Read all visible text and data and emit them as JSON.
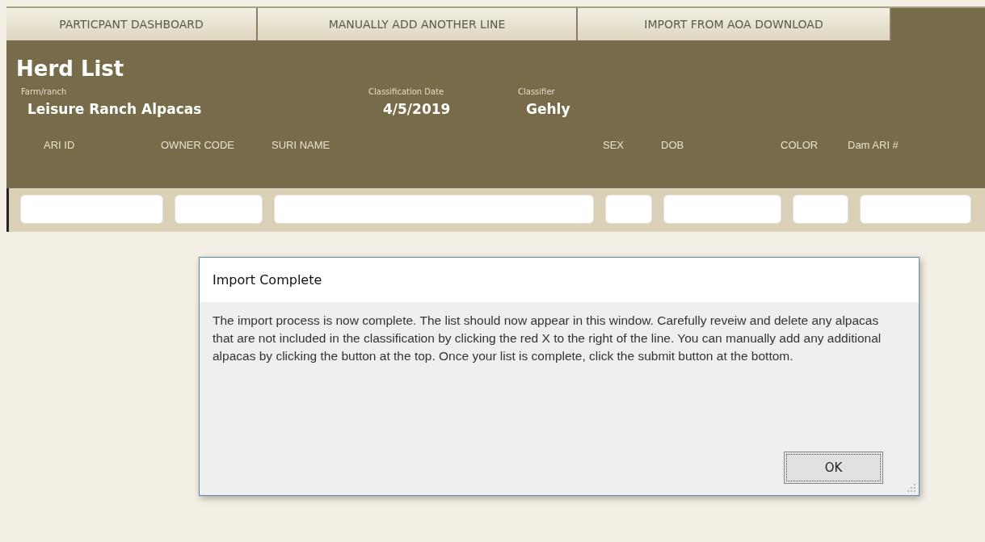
{
  "tabs": [
    {
      "label": "PARTICPANT DASHBOARD"
    },
    {
      "label": "MANUALLY ADD ANOTHER LINE"
    },
    {
      "label": "IMPORT FROM AOA DOWNLOAD"
    }
  ],
  "title": "Herd List",
  "info": [
    {
      "label": "Farm/ranch",
      "value": "Leisure Ranch Alpacas"
    },
    {
      "label": "Classification Date",
      "value": "4/5/2019"
    },
    {
      "label": "Classifier",
      "value": "Gehly"
    }
  ],
  "columns": [
    "ARI ID",
    "OWNER CODE",
    "SURI NAME",
    "SEX",
    "DOB",
    "COLOR",
    "Dam ARI #"
  ],
  "dialog": {
    "title": "Import Complete",
    "message": "The import process is now complete. The list should now appear in this window. Carefully reveiw and delete any alpacas that are not included in the classification by clicking the red X to the right of the line. You can manually add any additional alpacas by clicking the button at the top.  Once your list is complete, click the submit button at the bottom.",
    "button": "OK"
  }
}
